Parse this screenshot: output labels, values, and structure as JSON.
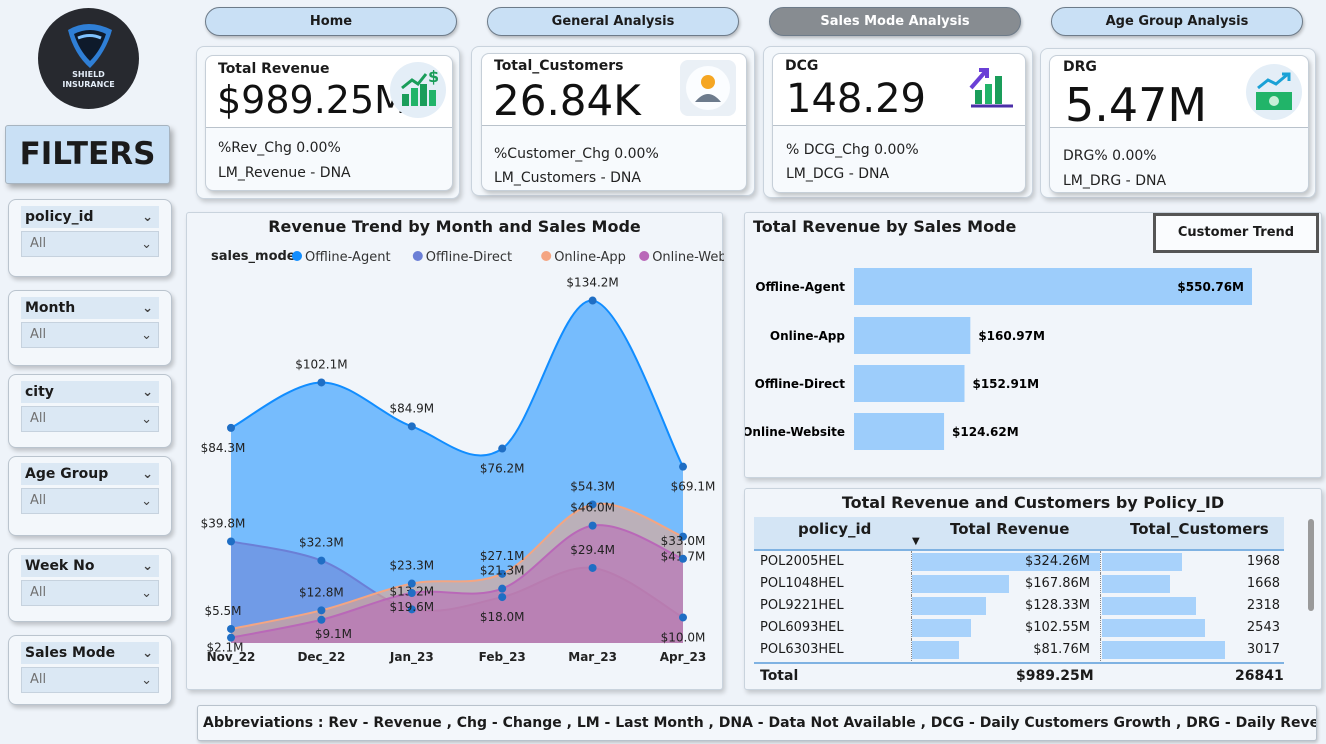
{
  "nav": {
    "home": "Home",
    "general": "General Analysis",
    "sales_mode": "Sales Mode Analysis",
    "age_group": "Age Group Analysis"
  },
  "logo": {
    "line1": "SHIELD",
    "line2": "INSURANCE"
  },
  "filters": {
    "title": "FILTERS",
    "slicers": [
      {
        "label": "policy_id",
        "value": "All"
      },
      {
        "label": "Month",
        "value": "All"
      },
      {
        "label": "city",
        "value": "All"
      },
      {
        "label": "Age Group",
        "value": "All"
      },
      {
        "label": "Week No",
        "value": "All"
      },
      {
        "label": "Sales Mode",
        "value": "All"
      }
    ]
  },
  "kpis": {
    "revenue": {
      "label": "Total Revenue",
      "value": "$989.25M",
      "chg": "%Rev_Chg 0.00%",
      "lm": "LM_Revenue - DNA"
    },
    "customers": {
      "label": "Total_Customers",
      "value": "26.84K",
      "chg": "%Customer_Chg 0.00%",
      "lm": "LM_Customers - DNA"
    },
    "dcg": {
      "label": "DCG",
      "value": "148.29",
      "chg": "% DCG_Chg 0.00%",
      "lm": "LM_DCG - DNA"
    },
    "drg": {
      "label": "DRG",
      "value": "5.47M",
      "chg": "DRG% 0.00%",
      "lm": "LM_DRG - DNA"
    }
  },
  "trend_chart": {
    "title": "Revenue Trend by Month and Sales Mode",
    "legend_title": "sales_mode",
    "chart_data": {
      "type": "area",
      "categories": [
        "Nov_22",
        "Dec_22",
        "Jan_23",
        "Feb_23",
        "Mar_23",
        "Apr_23"
      ],
      "series": [
        {
          "name": "Offline-Agent",
          "color": "#118DFF",
          "values": [
            84.3,
            102.1,
            84.9,
            76.2,
            134.2,
            69.1
          ],
          "labels": [
            "$84.3M",
            "$102.1M",
            "$84.9M",
            "$76.2M",
            "$134.2M",
            "$69.1M"
          ]
        },
        {
          "name": "Offline-Direct",
          "color": "#6B7FD6",
          "values": [
            39.8,
            32.3,
            13.2,
            18.0,
            29.4,
            10.0
          ],
          "labels": [
            "$39.8M",
            "$32.3M",
            "$13.2M",
            "$18.0M",
            "$29.4M",
            "$10.0M"
          ]
        },
        {
          "name": "Online-App",
          "color": "#F4A582",
          "values": [
            5.5,
            12.8,
            23.3,
            27.1,
            54.3,
            41.7
          ],
          "labels": [
            "$5.5M",
            "$12.8M",
            "$23.3M",
            "$27.1M",
            "$54.3M",
            "$41.7M"
          ]
        },
        {
          "name": "Online-Website",
          "color": "#B968B8",
          "values": [
            2.1,
            9.1,
            19.6,
            21.3,
            46.0,
            33.0
          ],
          "labels": [
            "$2.1M",
            "$9.1M",
            "$19.6M",
            "$21.3M",
            "$46.0M",
            "$33.0M"
          ]
        }
      ]
    }
  },
  "bar_chart": {
    "title": "Total Revenue by Sales Mode",
    "button": "Customer Trend",
    "chart_data": {
      "type": "bar",
      "categories": [
        "Offline-Agent",
        "Online-App",
        "Offline-Direct",
        "Online-Website"
      ],
      "values": [
        550.76,
        160.97,
        152.91,
        124.62
      ],
      "labels": [
        "$550.76M",
        "$160.97M",
        "$152.91M",
        "$124.62M"
      ],
      "color": "#9DCDFB"
    }
  },
  "table": {
    "title": "Total Revenue and Customers by Policy_ID",
    "headers": [
      "policy_id",
      "Total Revenue",
      "Total_Customers"
    ],
    "rows": [
      {
        "policy_id": "POL2005HEL",
        "revenue": "$324.26M",
        "rev_val": 324.26,
        "customers": "1968",
        "cust_val": 1968
      },
      {
        "policy_id": "POL1048HEL",
        "revenue": "$167.86M",
        "rev_val": 167.86,
        "customers": "1668",
        "cust_val": 1668
      },
      {
        "policy_id": "POL9221HEL",
        "revenue": "$128.33M",
        "rev_val": 128.33,
        "customers": "2318",
        "cust_val": 2318
      },
      {
        "policy_id": "POL6093HEL",
        "revenue": "$102.55M",
        "rev_val": 102.55,
        "customers": "2543",
        "cust_val": 2543
      },
      {
        "policy_id": "POL6303HEL",
        "revenue": "$81.76M",
        "rev_val": 81.76,
        "customers": "3017",
        "cust_val": 3017
      }
    ],
    "total": {
      "label": "Total",
      "revenue": "$989.25M",
      "customers": "26841"
    }
  },
  "footer": "Abbreviations : Rev - Revenue , Chg  - Change , LM - Last Month , DNA - Data Not Available , DCG - Daily Customers Growth , DRG - Daily Revenue Growth"
}
